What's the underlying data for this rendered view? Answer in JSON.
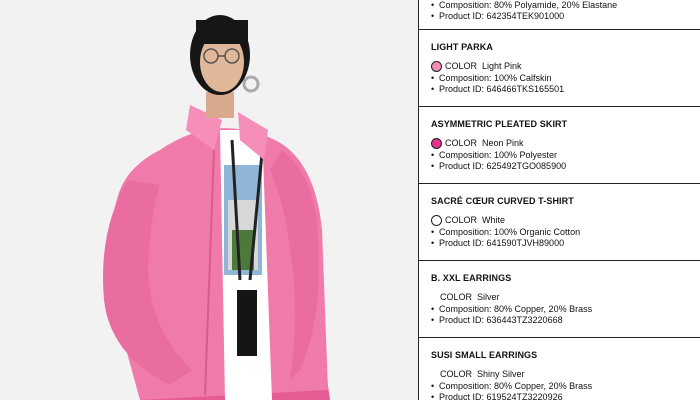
{
  "cards": [
    {
      "title": "",
      "composition": "Composition: 80% Polyamide, 20% Elastane",
      "product_id": "Product ID: 642354TEK901000"
    },
    {
      "title": "LIGHT PARKA",
      "color_label": "COLOR",
      "color_name": "Light Pink",
      "swatch": "#f28bb6",
      "composition": "Composition: 100% Calfskin",
      "product_id": "Product ID: 646466TKS165501"
    },
    {
      "title": "ASYMMETRIC PLEATED SKIRT",
      "color_label": "COLOR",
      "color_name": "Neon Pink",
      "swatch": "#e3338d",
      "composition": "Composition: 100% Polyester",
      "product_id": "Product ID: 625492TGO085900"
    },
    {
      "title": "SACRÉ CŒUR CURVED T-SHIRT",
      "color_label": "COLOR",
      "color_name": "White",
      "swatch": "#ffffff",
      "composition": "Composition: 100% Organic Cotton",
      "product_id": "Product ID: 641590TJVH89000"
    },
    {
      "title": "B. XXL EARRINGS",
      "color_label": "COLOR",
      "color_name": "Silver",
      "composition": "Composition: 80% Copper, 20% Brass",
      "product_id": "Product ID: 636443TZ3220668"
    },
    {
      "title": "SUSI SMALL EARRINGS",
      "color_label": "COLOR",
      "color_name": "Shiny Silver",
      "composition": "Composition: 80% Copper, 20% Brass",
      "product_id": "Product ID: 619524TZ3220926"
    }
  ],
  "colors": {
    "jacket": "#f07aaa",
    "jacket_shadow": "#d95a8c",
    "background": "#f2f2f2",
    "divider": "#222222"
  },
  "icons": {
    "bullet": "•"
  }
}
